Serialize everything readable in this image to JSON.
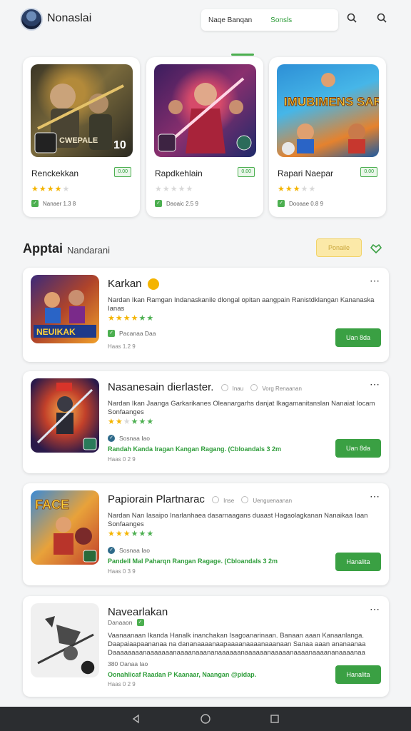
{
  "header": {
    "title": "Nonaslai",
    "search_placeholder": "Naqe Banqan",
    "sort_label": "Sonsls"
  },
  "featured": [
    {
      "name": "Renckekkan",
      "badge": "0.00",
      "rating": 4,
      "meta": "Nanaer 1.3 8"
    },
    {
      "name": "Rapdkehlain",
      "badge": "0.00",
      "rating": 0,
      "meta": "Daoaic 2.5 9"
    },
    {
      "name": "Rapari Naepar",
      "badge": "0.00",
      "rating": 3,
      "meta": "Dooaae 0.8 9"
    }
  ],
  "featured_art_text": [
    "CWEPALE",
    "10",
    "IMUBIMENS SARI SARIS"
  ],
  "section": {
    "title": "Apptai",
    "subtitle": "Nandarani",
    "filter_label": "Ponaile"
  },
  "apps": [
    {
      "title": "Karkan",
      "desc": "Nardan Ikan Ramgan  Indanaskanile dlongal opitan aangpain Ranistdklangan Kananaska Ianas",
      "rating": 5,
      "row": "Pacanaa Daa",
      "small": "Haas 1.2 9",
      "green": "",
      "action": "Uan 8da",
      "thumb_text": "NEUIKAK"
    },
    {
      "title": "Nasanesain dierlaster.",
      "tag1": "Inau",
      "tag2": "Vorg Renaanan",
      "desc": "Nardan Ikan Jaanga  Garkarikanes Oleanargarhs danjat Ikagamanitanslan Nanaiat Iocam Sonfaanges",
      "rating": 5,
      "row": "Sosnaa Iao",
      "green": "Randah Kanda Iragan Kangan Ragang. (Cbloandals 3 2m",
      "small": "Haas 0 2 9",
      "action": "Uan 8da"
    },
    {
      "title": "Papiorain Plartnarac",
      "tag1": "Inse",
      "tag2": "Uenguenaanan",
      "desc": "Nardan Nan Iasaipo Inarlanhaea dasarnaagans duaast Hagaolagkanan Nanaikaa Iaan  Sonfaanges",
      "rating": 5,
      "row": "Sosnaa Iao",
      "green": "Pandell Mal Paharqn Rangan Ragage. (Cbloandals 3 2m",
      "small": "Haas 0 3 9",
      "action": "Hanalita",
      "thumb_text": "FACE"
    },
    {
      "title": "Navearlakan",
      "tag1": "Danaaon",
      "desc": "Vaanaanaan Ikanda  Hanalk  inanchakan Isagoanarinaan. Banaan aaan Kanaanlanga. Daapaiaapaananaa na dananaaaanaapaaaanaaaanaaanaan Sanaa aaan  ananaanaa Daaaaaaaanaaaaaaanaaaanaaananaaaaaanaaaaaanaaaaanaaaanaaaananaaaanaa",
      "rating": 0,
      "row": "380 Oanaa Iao",
      "green": "Oonahlicaf Raadan  P Kaanaar, Naangan @pidap.",
      "small": "Haas 0 2 9",
      "action": "Hanalita"
    }
  ],
  "colors": {
    "accent": "#3aa043",
    "star": "#f4b400",
    "filter": "#fbe9a8",
    "navbar": "#2b2d30"
  }
}
